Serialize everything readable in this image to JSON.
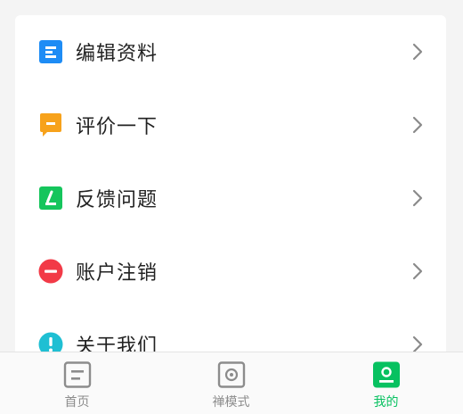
{
  "menu": {
    "items": [
      {
        "label": "编辑资料",
        "icon": "edit-profile-icon",
        "color": "#1e8cf5"
      },
      {
        "label": "评价一下",
        "icon": "rate-icon",
        "color": "#f7a21b"
      },
      {
        "label": "反馈问题",
        "icon": "feedback-icon",
        "color": "#15c55c"
      },
      {
        "label": "账户注销",
        "icon": "delete-account-icon",
        "color": "#f23a47"
      },
      {
        "label": "关于我们",
        "icon": "info-icon",
        "color": "#1fbfd3"
      }
    ]
  },
  "tabbar": {
    "tabs": [
      {
        "label": "首页",
        "icon": "home-icon",
        "active": false
      },
      {
        "label": "禅模式",
        "icon": "zen-mode-icon",
        "active": false
      },
      {
        "label": "我的",
        "icon": "profile-icon",
        "active": true
      }
    ],
    "active_color": "#07c160",
    "inactive_color": "#8c8c8c"
  }
}
